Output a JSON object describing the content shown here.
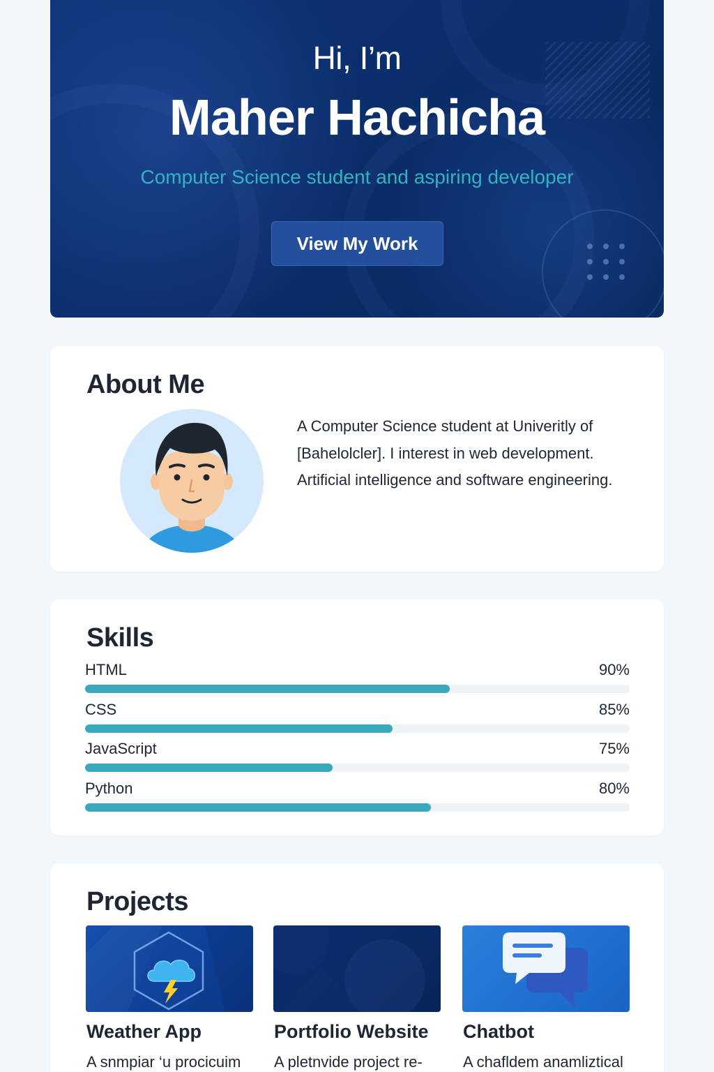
{
  "hero": {
    "greeting": "Hi, I’m",
    "name": "Maher Hachicha",
    "tagline": "Computer Science student and aspiring developer",
    "cta_label": "View My Work"
  },
  "about": {
    "title": "About Me",
    "lines": [
      "A Computer Science student at Univeritly of",
      "[Bahelolcler]. I interest in web development.",
      "Artificial intelligence and software engineering."
    ]
  },
  "skills": {
    "title": "Skills",
    "items": [
      {
        "name": "HTML",
        "percent_label": "90%",
        "fill": 0.67
      },
      {
        "name": "CSS",
        "percent_label": "85%",
        "fill": 0.565
      },
      {
        "name": "JavaScript",
        "percent_label": "75%",
        "fill": 0.455
      },
      {
        "name": "Python",
        "percent_label": "80%",
        "fill": 0.635
      }
    ]
  },
  "projects": {
    "title": "Projects",
    "items": [
      {
        "title": "Weather App",
        "description": "A snmpiar ‘u procicuim",
        "icon": "cloud-lightning-icon"
      },
      {
        "title": "Portfolio Website",
        "description": "A pletnvide project re-",
        "icon": ""
      },
      {
        "title": "Chatbot",
        "description": "A chafldem anamliztical",
        "icon": "chat-bubbles-icon"
      }
    ]
  },
  "colors": {
    "hero_background": "#0b2e6c",
    "accent": "#33b2c4",
    "skill_bar": "#3aa8bd",
    "page_background": "#f2f7fb"
  }
}
